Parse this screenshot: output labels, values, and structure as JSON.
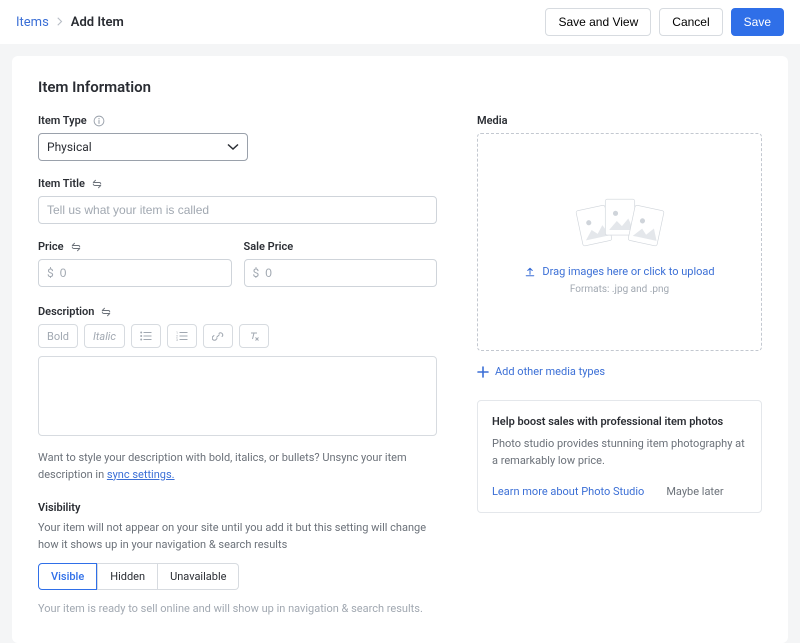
{
  "breadcrumb": {
    "items_label": "Items",
    "current": "Add Item"
  },
  "actions": {
    "save_and_view": "Save and View",
    "cancel": "Cancel",
    "save": "Save"
  },
  "section_title": "Item Information",
  "item_type": {
    "label": "Item Type",
    "value": "Physical"
  },
  "item_title": {
    "label": "Item Title",
    "placeholder": "Tell us what your item is called"
  },
  "price": {
    "label": "Price",
    "currency": "$",
    "value": "0"
  },
  "sale_price": {
    "label": "Sale Price",
    "currency": "$",
    "value": "0"
  },
  "description": {
    "label": "Description",
    "toolbar": {
      "bold": "Bold",
      "italic": "Italic"
    },
    "hint_prefix": "Want to style your description with bold, italics, or bullets? Unsync your item description in ",
    "hint_link": "sync settings."
  },
  "visibility": {
    "label": "Visibility",
    "desc": "Your item will not appear on your site until you add it but this setting will change how it shows up in your navigation & search results",
    "options": [
      "Visible",
      "Hidden",
      "Unavailable"
    ],
    "active_index": 0,
    "footer": "Your item is ready to sell online and will show up in navigation & search results."
  },
  "media": {
    "label": "Media",
    "drop_cta": "Drag images here or click to upload",
    "formats": "Formats: .jpg and .png",
    "add_other": "Add other media types"
  },
  "promo": {
    "title": "Help boost sales with professional item photos",
    "text": "Photo studio provides stunning item photography at a remarkably low price.",
    "learn": "Learn more about Photo Studio",
    "later": "Maybe later"
  }
}
